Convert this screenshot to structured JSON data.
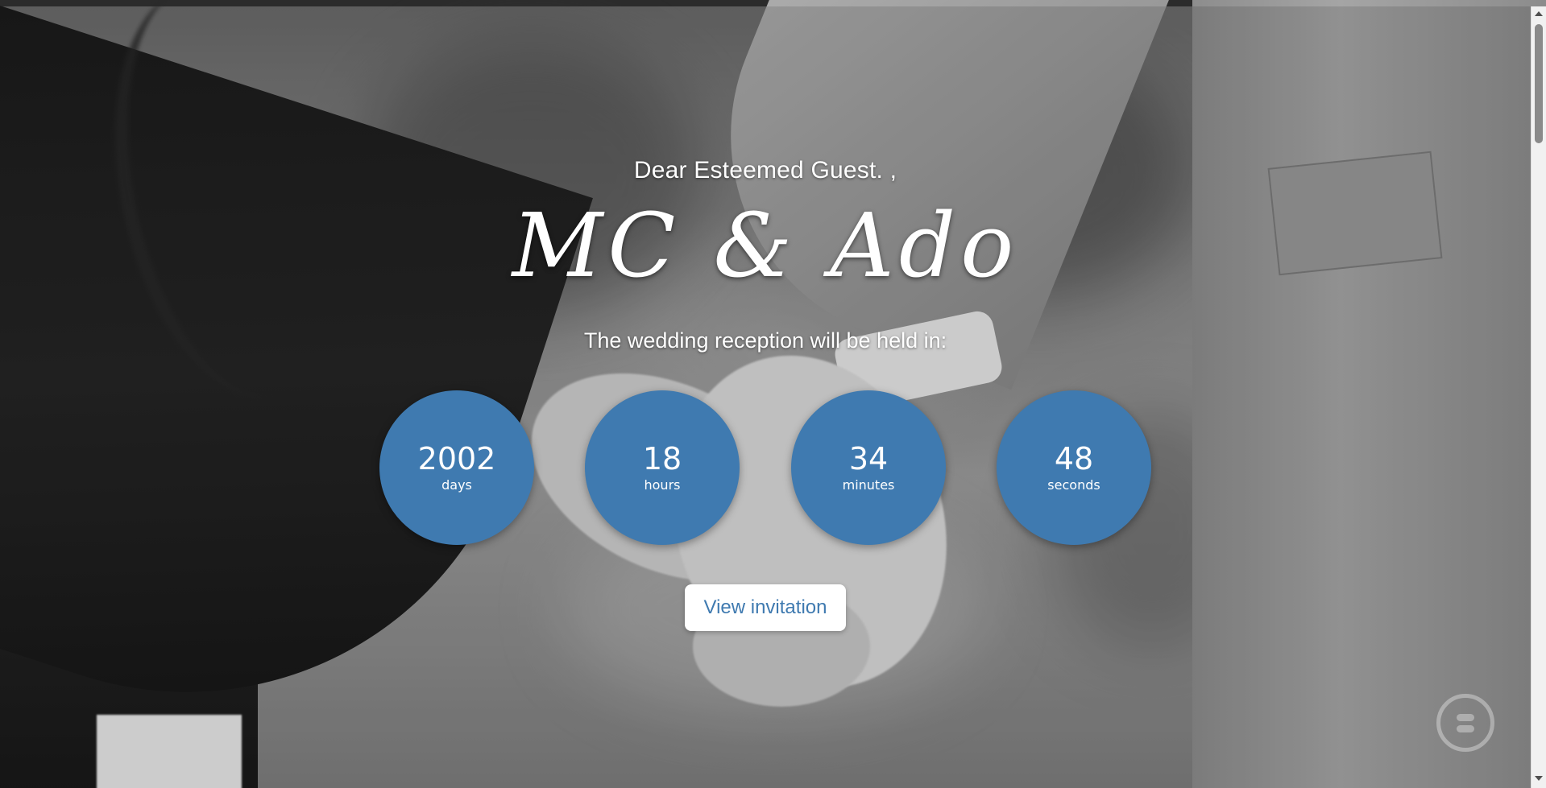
{
  "hero": {
    "greeting": "Dear Esteemed Guest. ,",
    "couple_names": "MC & Ado",
    "subtitle": "The wedding reception will be held in:"
  },
  "countdown": {
    "items": [
      {
        "value": "2002",
        "unit": "days"
      },
      {
        "value": "18",
        "unit": "hours"
      },
      {
        "value": "34",
        "unit": "minutes"
      },
      {
        "value": "48",
        "unit": "seconds"
      }
    ],
    "circle_color": "#3f7ab0"
  },
  "actions": {
    "view_invitation_label": "View invitation"
  },
  "floating_button": {
    "icon": "music-toggle-icon"
  },
  "scrollbar": {
    "thumb_position": 0.02
  }
}
